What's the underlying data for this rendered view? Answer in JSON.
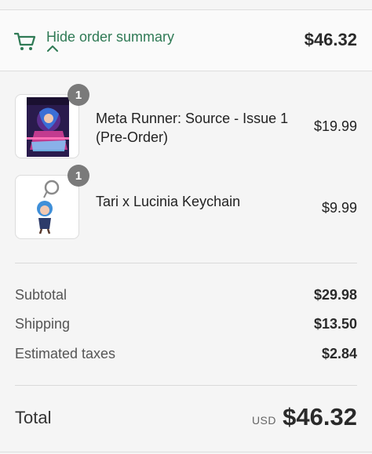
{
  "header": {
    "toggle_label": "Hide order summary",
    "total": "$46.32"
  },
  "items": [
    {
      "quantity": "1",
      "title": "Meta Runner: Source - Issue 1 (Pre-Order)",
      "price": "$19.99",
      "image": "comic-cover"
    },
    {
      "quantity": "1",
      "title": "Tari x Lucinia Keychain",
      "price": "$9.99",
      "image": "keychain"
    }
  ],
  "summary": {
    "subtotal_label": "Subtotal",
    "subtotal_value": "$29.98",
    "shipping_label": "Shipping",
    "shipping_value": "$13.50",
    "taxes_label": "Estimated taxes",
    "taxes_value": "$2.84"
  },
  "total": {
    "label": "Total",
    "currency": "USD",
    "value": "$46.32"
  },
  "colors": {
    "accent": "#2f7a55",
    "badge": "#7a7a7a"
  }
}
